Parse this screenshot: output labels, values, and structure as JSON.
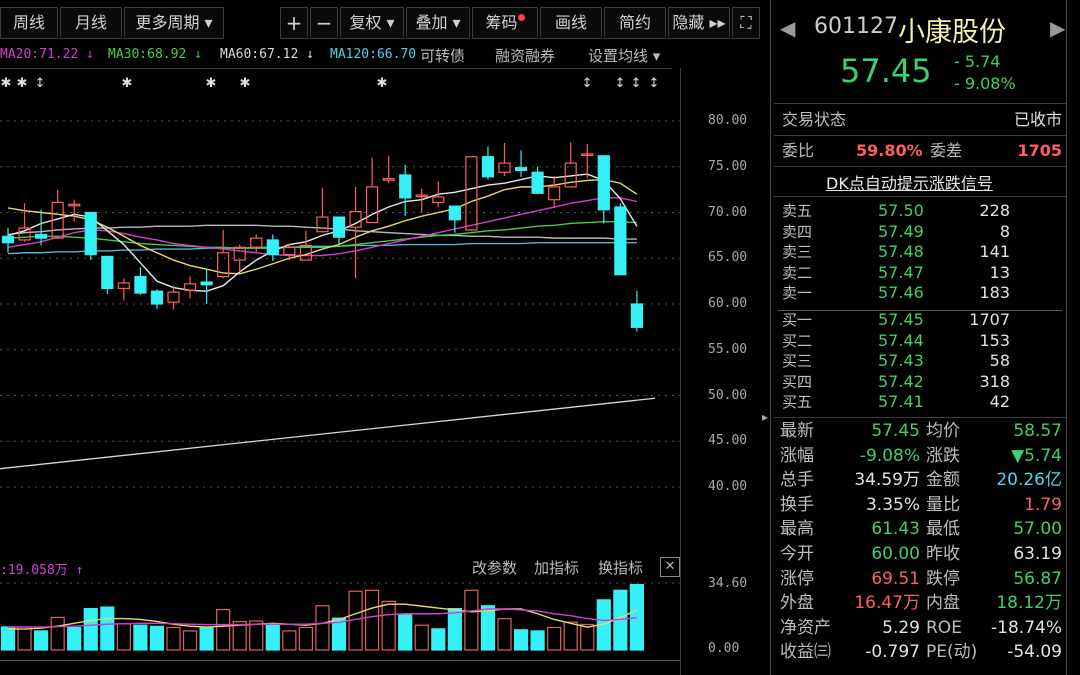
{
  "toolbar": {
    "items": [
      "周线",
      "月线",
      "更多周期 ▾",
      "+",
      "−",
      "复权 ▾",
      "叠加 ▾",
      "筹码",
      "画线",
      "简约",
      "隐藏 ▸▸",
      "⛶"
    ]
  },
  "ma_legend": {
    "ma20": "MA20:71.22 ↓",
    "ma30": "MA30:68.92 ↓",
    "ma60": "MA60:67.12 ↓",
    "ma120": "MA120:66.70",
    "convertible": "可转债",
    "margin": "融资融券",
    "settings": "设置均线 ▾"
  },
  "colors": {
    "up": "#ff5d5d",
    "down": "#35f0f5",
    "ma5": "#e8e8e8",
    "ma10": "#e6d86a",
    "ma20": "#d040d0",
    "ma30": "#45c845",
    "ma60": "#b8b8b8",
    "ma120": "#58b4d0",
    "long": "#d8d8d8"
  },
  "chart_data": [
    {
      "type": "candlestick",
      "title": "小康股份 日K",
      "ylim": [
        40,
        80
      ],
      "yticks": [
        "80.00",
        "75.00",
        "70.00",
        "65.00",
        "60.00",
        "55.00",
        "50.00",
        "45.00",
        "40.00"
      ],
      "ohlc": [
        [
          67.4,
          66.7,
          68.3,
          65.6
        ],
        [
          67.0,
          68.3,
          71.0,
          66.8
        ],
        [
          67.6,
          67.2,
          70.3,
          66.4
        ],
        [
          67.2,
          71.1,
          72.5,
          67.2
        ],
        [
          70.8,
          70.9,
          71.4,
          69.0
        ],
        [
          70.0,
          65.4,
          70.0,
          64.8
        ],
        [
          65.2,
          61.7,
          65.2,
          61.1
        ],
        [
          61.7,
          62.3,
          62.8,
          60.4
        ],
        [
          63.0,
          61.2,
          64.0,
          61.0
        ],
        [
          61.4,
          60.0,
          61.6,
          59.5
        ],
        [
          60.2,
          61.3,
          62.0,
          59.4
        ],
        [
          61.5,
          62.2,
          63.0,
          60.6
        ],
        [
          62.4,
          62.1,
          63.8,
          60.0
        ],
        [
          63.0,
          65.6,
          68.1,
          62.8
        ],
        [
          64.8,
          66.2,
          66.5,
          63.5
        ],
        [
          66.2,
          67.2,
          67.6,
          65.7
        ],
        [
          67.0,
          65.4,
          67.6,
          64.7
        ],
        [
          65.4,
          66.2,
          66.6,
          64.8
        ],
        [
          64.8,
          66.4,
          68.0,
          64.8
        ],
        [
          67.9,
          69.5,
          72.7,
          67.8
        ],
        [
          69.5,
          67.3,
          69.5,
          66.5
        ],
        [
          68.4,
          70.1,
          72.8,
          62.8
        ],
        [
          68.9,
          72.8,
          76.0,
          68.9
        ],
        [
          73.6,
          73.7,
          76.2,
          73.2
        ],
        [
          74.1,
          71.6,
          75.2,
          69.6
        ],
        [
          71.9,
          71.9,
          72.6,
          70.0
        ],
        [
          71.1,
          71.7,
          73.4,
          70.6
        ],
        [
          70.7,
          69.2,
          70.7,
          67.8
        ],
        [
          68.1,
          76.1,
          76.1,
          68.0
        ],
        [
          76.1,
          73.9,
          77.2,
          73.6
        ],
        [
          74.4,
          75.4,
          77.6,
          74.0
        ],
        [
          74.9,
          74.6,
          76.8,
          73.9
        ],
        [
          74.4,
          72.1,
          75.0,
          72.1
        ],
        [
          71.4,
          72.8,
          74.0,
          70.5
        ],
        [
          72.8,
          75.4,
          77.7,
          72.8
        ],
        [
          76.4,
          76.4,
          77.5,
          73.8
        ],
        [
          76.2,
          70.3,
          76.2,
          68.8
        ],
        [
          70.6,
          63.2,
          71.0,
          63.2
        ],
        [
          60.0,
          57.45,
          61.43,
          57.0
        ]
      ],
      "ma": {
        "ma5": [
          67.5,
          68,
          68.8,
          69.3,
          69.8,
          69.5,
          68,
          66.5,
          64.5,
          62.5,
          61.8,
          61.5,
          61.4,
          62,
          63.5,
          64.8,
          65.8,
          66.5,
          66.8,
          67.5,
          68,
          68.8,
          69.8,
          70.6,
          71.2,
          71.4,
          72,
          72.2,
          72.6,
          73,
          73.2,
          73.6,
          74,
          73.8,
          74,
          74.2,
          73.5,
          71.5,
          68.5
        ],
        "ma10": [
          70.5,
          70.2,
          70,
          69.8,
          69.6,
          69.2,
          68.4,
          67.4,
          66.4,
          65.6,
          64.8,
          64.2,
          63.8,
          63.4,
          63.3,
          63.8,
          64.4,
          65,
          65.4,
          66,
          66.5,
          67.3,
          68,
          68.5,
          69.1,
          69.6,
          70,
          70.4,
          71.2,
          71.8,
          72.5,
          72.8,
          72.8,
          73,
          73.3,
          73.5,
          73.6,
          73.2,
          72
        ],
        "ma20": [
          66.2,
          66.5,
          66.8,
          67.3,
          67.8,
          68.1,
          68.0,
          67.7,
          67.3,
          67,
          66.6,
          66.4,
          66.2,
          66,
          65.8,
          65.6,
          65.4,
          65.3,
          65.3,
          65.3,
          65.5,
          65.8,
          66.2,
          66.6,
          67,
          67.4,
          67.8,
          68.2,
          68.6,
          69.0,
          69.4,
          69.8,
          70.2,
          70.6,
          71,
          71.3,
          71.6,
          71.6,
          71.2
        ],
        "ma30": [
          67.2,
          67.3,
          67.4,
          67.4,
          67.3,
          67.2,
          67.0,
          66.8,
          66.6,
          66.5,
          66.4,
          66.3,
          66.2,
          66.2,
          66.1,
          66.1,
          66.1,
          66.2,
          66.2,
          66.2,
          66.3,
          66.5,
          66.7,
          66.9,
          67.1,
          67.3,
          67.5,
          67.6,
          67.8,
          68,
          68.1,
          68.3,
          68.5,
          68.6,
          68.8,
          68.9,
          69,
          69,
          68.9
        ],
        "ma60": [
          67.6,
          67.8,
          67.9,
          68.1,
          68.2,
          68.3,
          68.3,
          68.4,
          68.4,
          68.5,
          68.5,
          68.5,
          68.6,
          68.6,
          68.6,
          68.6,
          68.5,
          68.5,
          68.4,
          68.3,
          68.2,
          68,
          67.9,
          67.8,
          67.7,
          67.6,
          67.5,
          67.5,
          67.4,
          67.4,
          67.3,
          67.3,
          67.3,
          67.2,
          67.2,
          67.2,
          67.2,
          67.1,
          67.1
        ],
        "ma120": [
          65.5,
          65.6,
          65.6,
          65.7,
          65.7,
          65.8,
          65.8,
          65.9,
          65.9,
          66,
          66,
          66,
          66.1,
          66.1,
          66.1,
          66.2,
          66.2,
          66.2,
          66.3,
          66.3,
          66.3,
          66.4,
          66.4,
          66.4,
          66.5,
          66.5,
          66.5,
          66.5,
          66.6,
          66.6,
          66.6,
          66.6,
          66.7,
          66.7,
          66.7,
          66.7,
          66.7,
          66.7,
          66.7
        ],
        "long": [
          42.0,
          49.7
        ]
      }
    },
    {
      "type": "bar",
      "title": "成交量",
      "label": ":19.058万 ↑",
      "ylim": [
        0,
        34.6
      ],
      "yticks": [
        "34.60",
        "0.00"
      ],
      "values": [
        12.1,
        12.1,
        10,
        17.1,
        11.8,
        21.7,
        22.5,
        13.7,
        13,
        12.4,
        11.8,
        10,
        11.5,
        21.2,
        14.9,
        15.2,
        13.4,
        10,
        11.8,
        23.2,
        16.7,
        30.8,
        31.3,
        25.5,
        18.7,
        13,
        11.1,
        21.7,
        31.3,
        23.2,
        16.4,
        10.6,
        10,
        11.8,
        14.6,
        13.4,
        26.3,
        31.3,
        34.3
      ],
      "up": [
        0,
        1,
        0,
        1,
        0,
        0,
        0,
        1,
        0,
        0,
        1,
        1,
        0,
        1,
        1,
        1,
        0,
        1,
        1,
        1,
        0,
        1,
        1,
        1,
        0,
        1,
        0,
        0,
        1,
        0,
        1,
        0,
        0,
        1,
        1,
        1,
        0,
        0,
        0
      ],
      "ma5": [
        11,
        11,
        11.5,
        12.5,
        14,
        15.5,
        16.5,
        16.5,
        16,
        15,
        13.5,
        12.5,
        12,
        12.5,
        13,
        13.5,
        14,
        13.5,
        13,
        14,
        16,
        19,
        22,
        24,
        24,
        23,
        22,
        21,
        20,
        20.5,
        21.5,
        21.5,
        19,
        16,
        14,
        12,
        13.5,
        17,
        21
      ],
      "ma10": [
        12,
        12,
        12,
        12.2,
        12.5,
        13,
        13.5,
        13.8,
        14,
        14,
        13.8,
        13.5,
        13.3,
        13.3,
        13.3,
        13.5,
        13.5,
        13.5,
        13.5,
        14,
        14.5,
        16,
        17.5,
        18.5,
        19,
        19,
        19,
        19.5,
        20.5,
        21.5,
        21.5,
        21,
        20.5,
        19,
        18,
        16.5,
        15.5,
        16,
        17
      ]
    },
    [
      "改参数",
      "加指标",
      "换指标",
      "✕"
    ]
  ],
  "stock": {
    "code": "601127",
    "name": "小康股份",
    "price": "57.45",
    "change": "- 5.74",
    "change_pct": "- 9.08%"
  },
  "status": {
    "label": "交易状态",
    "value": "已收市"
  },
  "weibi": {
    "label": "委比",
    "value": "59.80%",
    "diff_label": "委差",
    "diff_value": "1705"
  },
  "dk_link": "DK点自动提示涨跌信号",
  "sell": [
    {
      "label": "卖五",
      "price": "57.50",
      "vol": "228"
    },
    {
      "label": "卖四",
      "price": "57.49",
      "vol": "8"
    },
    {
      "label": "卖三",
      "price": "57.48",
      "vol": "141"
    },
    {
      "label": "卖二",
      "price": "57.47",
      "vol": "13"
    },
    {
      "label": "卖一",
      "price": "57.46",
      "vol": "183"
    }
  ],
  "buy": [
    {
      "label": "买一",
      "price": "57.45",
      "vol": "1707"
    },
    {
      "label": "买二",
      "price": "57.44",
      "vol": "153"
    },
    {
      "label": "买三",
      "price": "57.43",
      "vol": "58"
    },
    {
      "label": "买四",
      "price": "57.42",
      "vol": "318"
    },
    {
      "label": "买五",
      "price": "57.41",
      "vol": "42"
    }
  ],
  "stats": [
    {
      "l1": "最新",
      "v1": "57.45",
      "c1": "g",
      "l2": "均价",
      "v2": "58.57",
      "c2": "g"
    },
    {
      "l1": "涨幅",
      "v1": "-9.08%",
      "c1": "g",
      "l2": "涨跌",
      "v2": "▼5.74",
      "c2": "g"
    },
    {
      "l1": "总手",
      "v1": "34.59万",
      "c1": "w",
      "l2": "金额",
      "v2": "20.26亿",
      "c2": "c"
    },
    {
      "l1": "换手",
      "v1": "3.35%",
      "c1": "w",
      "l2": "量比",
      "v2": "1.79",
      "c2": "r"
    },
    {
      "l1": "最高",
      "v1": "61.43",
      "c1": "g",
      "l2": "最低",
      "v2": "57.00",
      "c2": "g"
    },
    {
      "l1": "今开",
      "v1": "60.00",
      "c1": "g",
      "l2": "昨收",
      "v2": "63.19",
      "c2": "w"
    },
    {
      "l1": "涨停",
      "v1": "69.51",
      "c1": "r",
      "l2": "跌停",
      "v2": "56.87",
      "c2": "g"
    },
    {
      "l1": "外盘",
      "v1": "16.47万",
      "c1": "r",
      "l2": "内盘",
      "v2": "18.12万",
      "c2": "g"
    },
    {
      "l1": "净资产",
      "v1": "5.29",
      "c1": "w",
      "l2": "ROE",
      "v2": "-18.74%",
      "c2": "w"
    },
    {
      "l1": "收益㈢",
      "v1": "-0.797",
      "c1": "w",
      "l2": "PE(动)",
      "v2": "-54.09",
      "c2": "w"
    }
  ]
}
